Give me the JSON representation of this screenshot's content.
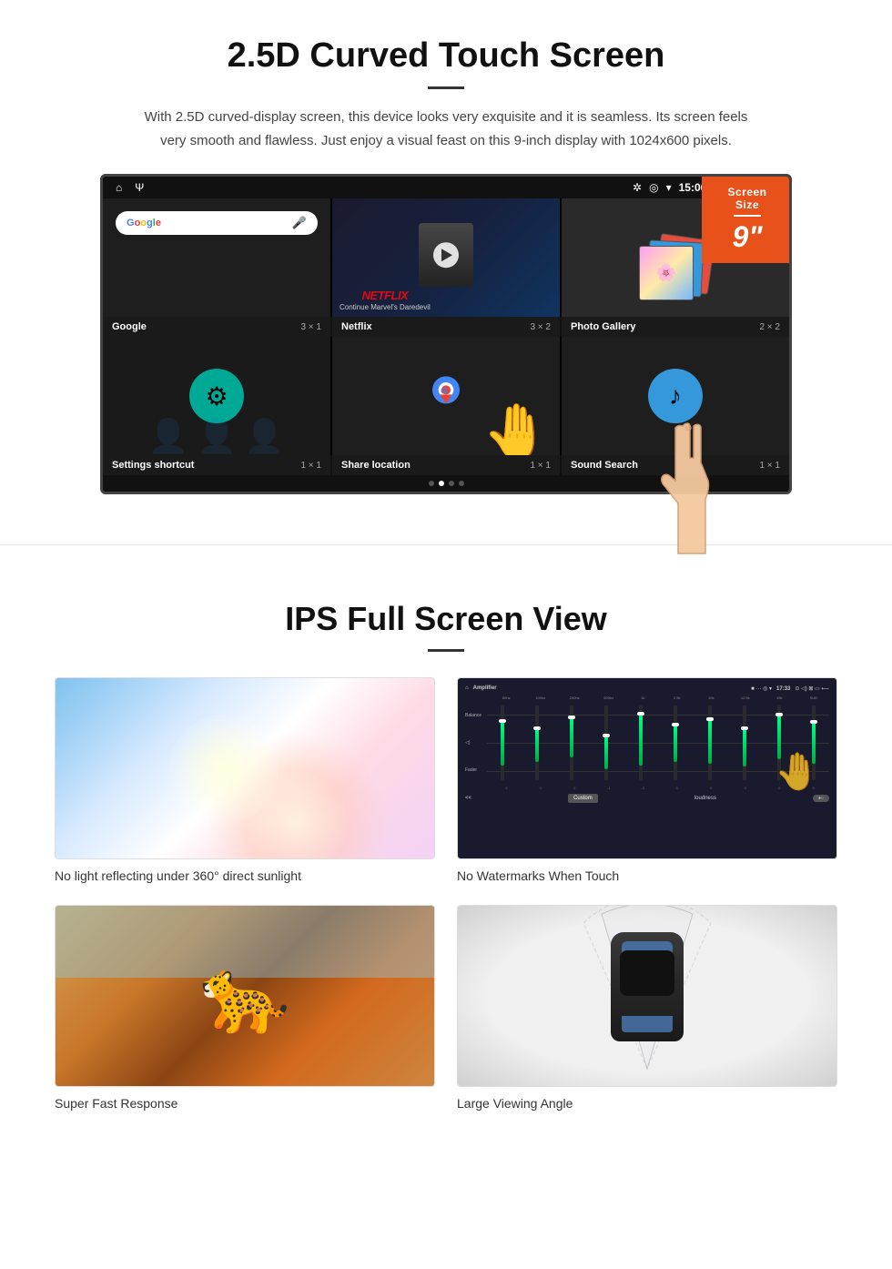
{
  "section1": {
    "title": "2.5D Curved Touch Screen",
    "description": "With 2.5D curved-display screen, this device looks very exquisite and it is seamless. Its screen feels very smooth and flawless. Just enjoy a visual feast on this 9-inch display with 1024x600 pixels.",
    "screen_size_badge": {
      "label": "Screen Size",
      "size": "9\""
    },
    "status_bar": {
      "time": "15:06"
    },
    "apps": [
      {
        "name": "Google",
        "size": "3 × 1"
      },
      {
        "name": "Netflix",
        "size": "3 × 2"
      },
      {
        "name": "Photo Gallery",
        "size": "2 × 2"
      }
    ],
    "apps_bottom": [
      {
        "name": "Settings shortcut",
        "size": "1 × 1"
      },
      {
        "name": "Share location",
        "size": "1 × 1"
      },
      {
        "name": "Sound Search",
        "size": "1 × 1"
      }
    ],
    "netflix_text": "NETFLIX",
    "netflix_sub": "Continue Marvel's Daredevil"
  },
  "section2": {
    "title": "IPS Full Screen View",
    "features": [
      {
        "id": "no-light-reflecting",
        "label": "No light reflecting under 360° direct sunlight"
      },
      {
        "id": "no-watermarks",
        "label": "No Watermarks When Touch"
      },
      {
        "id": "super-fast",
        "label": "Super Fast Response"
      },
      {
        "id": "large-viewing",
        "label": "Large Viewing Angle"
      }
    ],
    "amplifier": {
      "title": "Amplifier",
      "time": "17:33",
      "labels": [
        "60hz",
        "100hz",
        "200hz",
        "500hz",
        "1k",
        "2.5k",
        "10k",
        "12.5k",
        "15k",
        "SUB"
      ],
      "heights": [
        60,
        45,
        55,
        40,
        65,
        50,
        55,
        45,
        60,
        50
      ],
      "left_labels": [
        "Balance",
        "Fader"
      ],
      "bottom_left": "<<",
      "bottom_custom": "Custom",
      "bottom_loudness": "loudness"
    }
  }
}
